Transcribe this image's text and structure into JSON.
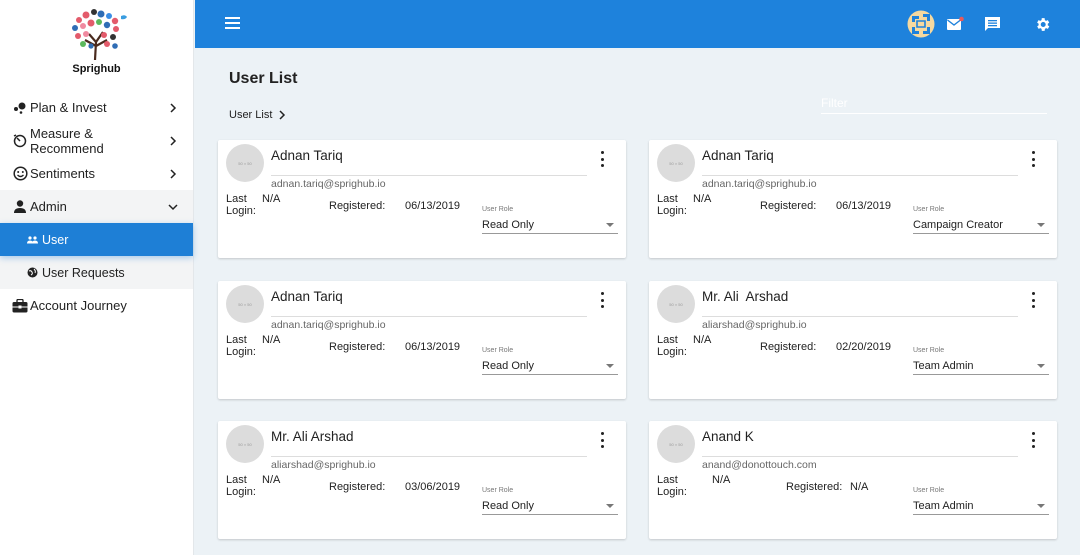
{
  "brand": {
    "name": "Sprighub"
  },
  "sidebar": {
    "items": [
      {
        "label": "Plan & Invest",
        "icon": "plan-icon",
        "expanded": false
      },
      {
        "label": "Measure & Recommend",
        "icon": "measure-icon",
        "expanded": false
      },
      {
        "label": "Sentiments",
        "icon": "smiley-icon",
        "expanded": false
      },
      {
        "label": "Admin",
        "icon": "person-icon",
        "expanded": true,
        "children": [
          {
            "label": "User",
            "icon": "users-icon",
            "active": true
          },
          {
            "label": "User Requests",
            "icon": "globe-icon",
            "active": false
          }
        ]
      },
      {
        "label": "Account Journey",
        "icon": "briefcase-icon",
        "expanded": false
      }
    ]
  },
  "topbar": {
    "icons": [
      "menu-icon",
      "app-logo-icon",
      "mail-icon",
      "chat-icon",
      "settings-icon"
    ],
    "mail_has_notification": true
  },
  "main": {
    "title": "User List",
    "breadcrumb": [
      "User List"
    ],
    "filter": {
      "placeholder": "Filter",
      "value": ""
    },
    "users": [
      {
        "name": "Adnan Tariq",
        "email": "adnan.tariq@sprighub.io",
        "last_login_label": "Last Login:",
        "last_login": "N/A",
        "registered_label": "Registered:",
        "registered": "06/13/2019",
        "role_label": "User Role",
        "role": "Read Only",
        "avatar_text": "50 × 50"
      },
      {
        "name": "Adnan Tariq",
        "email": "adnan.tariq@sprighub.io",
        "last_login_label": "Last Login:",
        "last_login": "N/A",
        "registered_label": "Registered:",
        "registered": "06/13/2019",
        "role_label": "User Role",
        "role": "Campaign Creator",
        "avatar_text": "50 × 50"
      },
      {
        "name": "Adnan Tariq",
        "email": "adnan.tariq@sprighub.io",
        "last_login_label": "Last Login:",
        "last_login": "N/A",
        "registered_label": "Registered:",
        "registered": "06/13/2019",
        "role_label": "User Role",
        "role": "Read Only",
        "avatar_text": "50 × 50"
      },
      {
        "name": "Mr. Ali  Arshad",
        "email": "aliarshad@sprighub.io",
        "last_login_label": "Last Login:",
        "last_login": "N/A",
        "registered_label": "Registered:",
        "registered": "02/20/2019",
        "role_label": "User Role",
        "role": "Team Admin",
        "avatar_text": "50 × 50"
      },
      {
        "name": "Mr. Ali Arshad",
        "email": "aliarshad@sprighub.io",
        "last_login_label": "Last Login:",
        "last_login": "N/A",
        "registered_label": "Registered:",
        "registered": "03/06/2019",
        "role_label": "User Role",
        "role": "Read Only",
        "avatar_text": "50 × 50"
      },
      {
        "name": "Anand K",
        "email": "anand@donottouch.com",
        "last_login_label": "Last Login:",
        "last_login": "N/A",
        "registered_label": "Registered:",
        "registered": "N/A",
        "role_label": "User Role",
        "role": "Team Admin",
        "avatar_text": "50 × 50"
      }
    ]
  },
  "colors": {
    "primary": "#1e82dc",
    "active_item": "#1e7fd6",
    "background": "#ecf2f6",
    "notification_dot": "#e85a5a",
    "logo_tile": "#f5d9a0"
  }
}
